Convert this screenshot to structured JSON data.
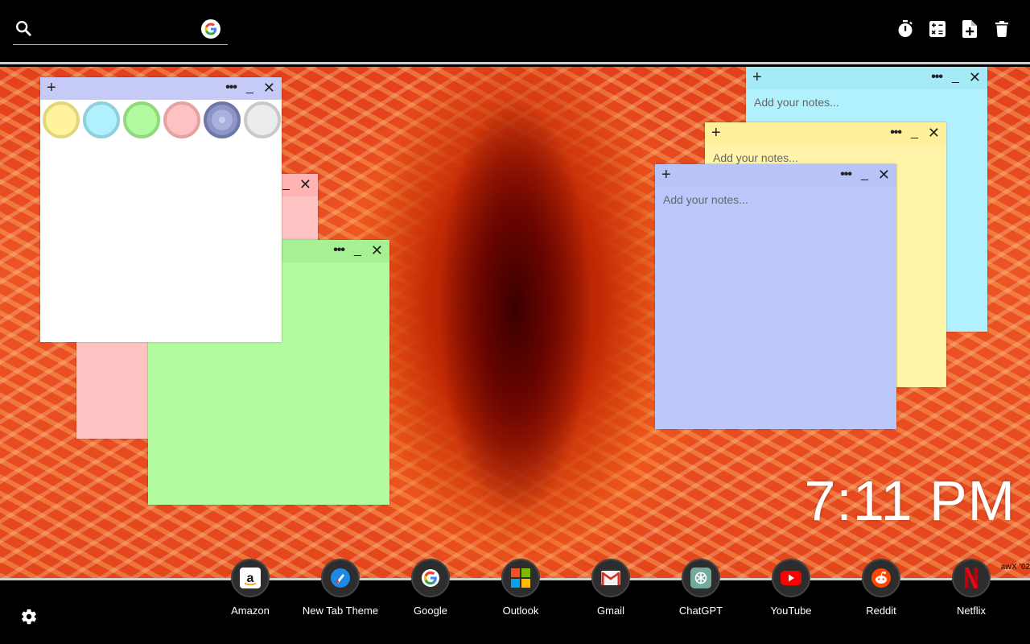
{
  "search": {
    "placeholder": ""
  },
  "toolbar": {
    "icons": [
      "timer-icon",
      "calculator-icon",
      "new-note-icon",
      "trash-icon"
    ]
  },
  "swatch_colors": [
    "#fff39d",
    "#b0f1fd",
    "#b3fba0",
    "#ffc2c2",
    "#8e96c9",
    "#ececec"
  ],
  "notes": {
    "add": "+",
    "menu": "•••",
    "minimize": "_",
    "close": "✕",
    "placeholder": "Add your notes..."
  },
  "clock": {
    "time": "7:11 PM"
  },
  "watermark": "awX '02",
  "dock": [
    {
      "label": "Amazon",
      "icon": "amazon-icon"
    },
    {
      "label": "New Tab Theme",
      "icon": "new-tab-theme-icon"
    },
    {
      "label": "Google",
      "icon": "google-icon"
    },
    {
      "label": "Outlook",
      "icon": "outlook-icon"
    },
    {
      "label": "Gmail",
      "icon": "gmail-icon"
    },
    {
      "label": "ChatGPT",
      "icon": "chatgpt-icon"
    },
    {
      "label": "YouTube",
      "icon": "youtube-icon"
    },
    {
      "label": "Reddit",
      "icon": "reddit-icon"
    },
    {
      "label": "Netflix",
      "icon": "netflix-icon"
    }
  ]
}
